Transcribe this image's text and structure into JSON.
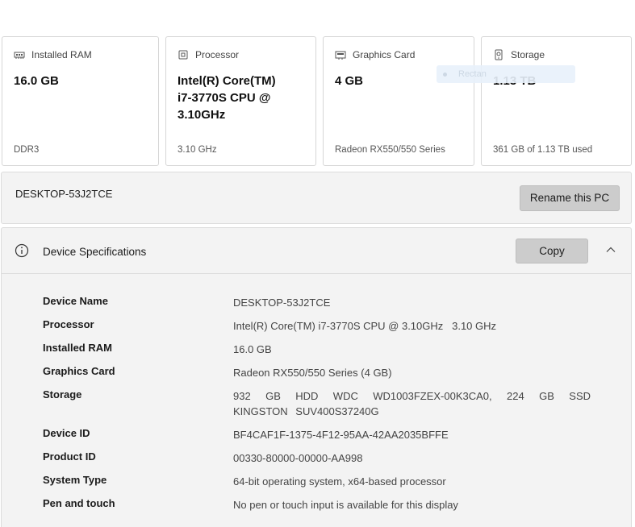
{
  "cards": [
    {
      "label": "Installed RAM",
      "icon": "ram-icon",
      "value": "16.0 GB",
      "sub": "DDR3"
    },
    {
      "label": "Processor",
      "icon": "processor-icon",
      "value": "Intel(R) Core(TM)\ni7-3770S CPU @\n3.10GHz",
      "sub": "3.10 GHz"
    },
    {
      "label": "Graphics Card",
      "icon": "graphics-card-icon",
      "value": "4 GB",
      "sub": "Radeon RX550/550 Series"
    },
    {
      "label": "Storage",
      "icon": "storage-icon",
      "value": "1.13 TB",
      "sub": "361 GB of 1.13 TB used"
    }
  ],
  "ghost_label": "Rectan",
  "rename": {
    "pc_name": "DESKTOP-53J2TCE",
    "button_label": "Rename this PC"
  },
  "specs": {
    "title": "Device Specifications",
    "copy_label": "Copy",
    "rows": [
      {
        "key": "Device Name",
        "value": "DESKTOP-53J2TCE"
      },
      {
        "key": "Processor",
        "value": "Intel(R) Core(TM) i7-3770S CPU @ 3.10GHz   3.10 GHz"
      },
      {
        "key": "Installed RAM",
        "value": "16.0 GB"
      },
      {
        "key": "Graphics Card",
        "value": "Radeon RX550/550 Series (4 GB)"
      },
      {
        "key": "Storage",
        "value": "932 GB HDD WDC WD1003FZEX-00K3CA0, 224 GB SSD KINGSTON SUV400S37240G"
      },
      {
        "key": "Device ID",
        "value": "BF4CAF1F-1375-4F12-95AA-42AA2035BFFE"
      },
      {
        "key": "Product ID",
        "value": "00330-80000-00000-AA998"
      },
      {
        "key": "System Type",
        "value": "64-bit operating system, x64-based processor"
      },
      {
        "key": "Pen and touch",
        "value": "No pen or touch input is available for this display"
      }
    ]
  }
}
